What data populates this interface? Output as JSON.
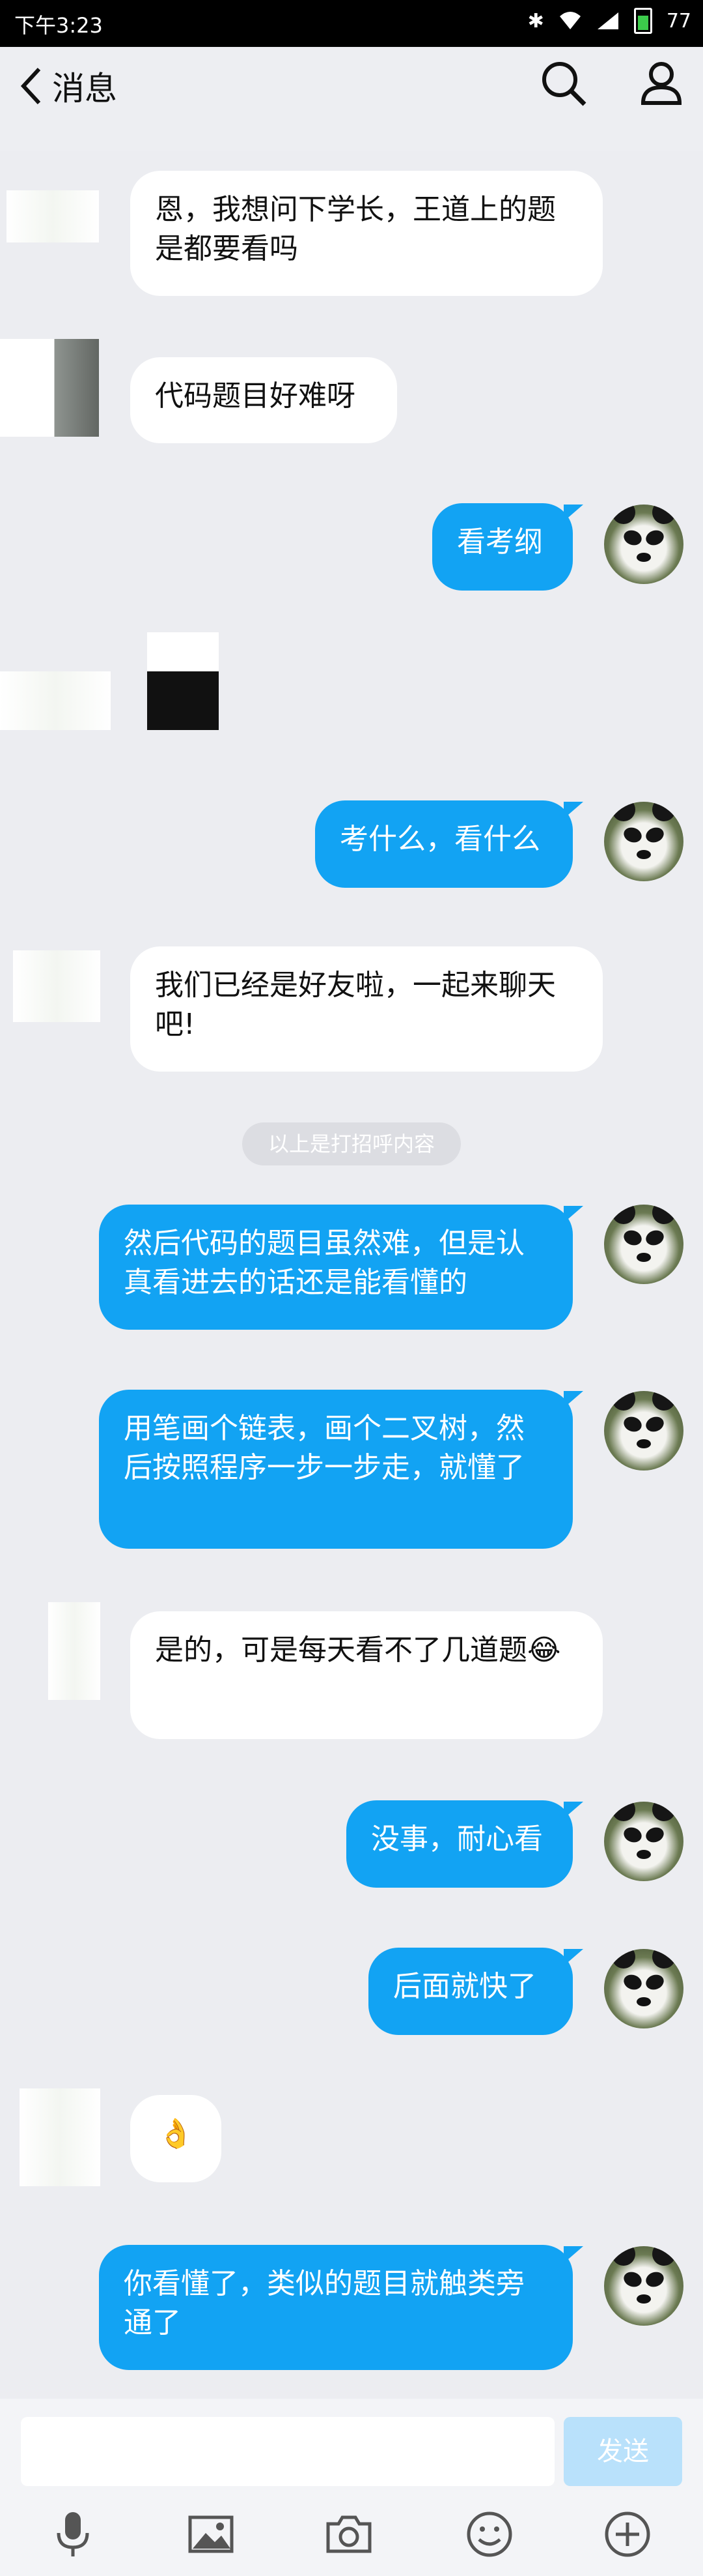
{
  "status": {
    "time": "下午3:23",
    "battery": "77"
  },
  "header": {
    "back_label": "消息"
  },
  "messages": [
    {
      "dir": "in",
      "text": "恩，我想问下学长，王道上的题是都要看吗"
    },
    {
      "dir": "in",
      "text": "代码题目好难呀"
    },
    {
      "dir": "out",
      "text": "看考纲"
    },
    {
      "dir": "out",
      "text": "考什么，看什么"
    },
    {
      "dir": "in",
      "text": "我们已经是好友啦，一起来聊天吧!"
    },
    {
      "dir": "out",
      "text": "然后代码的题目虽然难，但是认真看进去的话还是能看懂的"
    },
    {
      "dir": "out",
      "text": "用笔画个链表，画个二叉树，然后按照程序一步一步走，就懂了"
    },
    {
      "dir": "in",
      "text": "是的，可是每天看不了几道题😂"
    },
    {
      "dir": "out",
      "text": "没事，耐心看"
    },
    {
      "dir": "out",
      "text": "后面就快了"
    },
    {
      "dir": "in",
      "text": "👌"
    },
    {
      "dir": "out",
      "text": "你看懂了，类似的题目就触类旁通了"
    }
  ],
  "system_note": "以上是打招呼内容",
  "input": {
    "send_label": "发送",
    "placeholder": ""
  },
  "colors": {
    "outgoing": "#12A3F3",
    "incoming": "#FFFFFF",
    "background": "#ECEDF1"
  },
  "toolbar_icons": [
    "microphone-icon",
    "image-icon",
    "camera-icon",
    "emoji-icon",
    "plus-icon"
  ]
}
